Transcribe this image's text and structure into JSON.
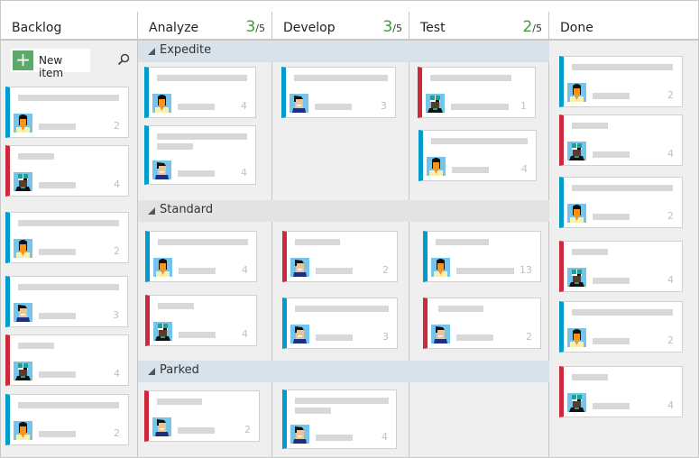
{
  "columns": [
    {
      "title": "Backlog"
    },
    {
      "title": "Analyze",
      "wip_current": "3",
      "wip_limit": "/5"
    },
    {
      "title": "Develop",
      "wip_current": "3",
      "wip_limit": "/5"
    },
    {
      "title": "Test",
      "wip_current": "2",
      "wip_limit": "/5"
    },
    {
      "title": "Done"
    }
  ],
  "backlog": {
    "new_item_label": "New item",
    "add_icon": "plus-icon",
    "search_icon": "search-icon"
  },
  "swimlanes": [
    {
      "label": "Expedite",
      "color": "#d7e2ea"
    },
    {
      "label": "Standard",
      "color": "#e3e3e3"
    },
    {
      "label": "Parked",
      "color": "#d7e2ea"
    }
  ],
  "colors": {
    "story": "#009ccc",
    "bug": "#cc293d",
    "wip_ok": "#3d9c3d",
    "new_item": "#5ea86b"
  },
  "cards": [
    {
      "col": 0,
      "type": "story",
      "avatar": "woman",
      "effort": "2"
    },
    {
      "col": 0,
      "type": "bug",
      "avatar": "cap",
      "effort": "4"
    },
    {
      "col": 0,
      "type": "story",
      "avatar": "woman",
      "effort": "2"
    },
    {
      "col": 0,
      "type": "story",
      "avatar": "man",
      "effort": "3"
    },
    {
      "col": 0,
      "type": "bug",
      "avatar": "cap",
      "effort": "4"
    },
    {
      "col": 0,
      "type": "story",
      "avatar": "woman",
      "effort": "2"
    },
    {
      "col": 1,
      "lane": "Expedite",
      "type": "story",
      "avatar": "woman",
      "effort": "4"
    },
    {
      "col": 1,
      "lane": "Expedite",
      "type": "story",
      "avatar": "man",
      "effort": "4"
    },
    {
      "col": 2,
      "lane": "Expedite",
      "type": "story",
      "avatar": "man",
      "effort": "3"
    },
    {
      "col": 3,
      "lane": "Expedite",
      "type": "bug",
      "avatar": "cap",
      "effort": "1"
    },
    {
      "col": 3,
      "lane": "Expedite",
      "type": "story",
      "avatar": "woman",
      "effort": "4"
    },
    {
      "col": 1,
      "lane": "Standard",
      "type": "story",
      "avatar": "woman",
      "effort": "4"
    },
    {
      "col": 1,
      "lane": "Standard",
      "type": "bug",
      "avatar": "cap",
      "effort": "4"
    },
    {
      "col": 2,
      "lane": "Standard",
      "type": "bug",
      "avatar": "man",
      "effort": "2"
    },
    {
      "col": 2,
      "lane": "Standard",
      "type": "story",
      "avatar": "man",
      "effort": "3"
    },
    {
      "col": 3,
      "lane": "Standard",
      "type": "story",
      "avatar": "woman",
      "effort": "13"
    },
    {
      "col": 3,
      "lane": "Standard",
      "type": "bug",
      "avatar": "man",
      "effort": "2"
    },
    {
      "col": 1,
      "lane": "Parked",
      "type": "bug",
      "avatar": "man",
      "effort": "2"
    },
    {
      "col": 2,
      "lane": "Parked",
      "type": "story",
      "avatar": "man",
      "effort": "4"
    },
    {
      "col": 4,
      "type": "story",
      "avatar": "woman",
      "effort": "2"
    },
    {
      "col": 4,
      "type": "bug",
      "avatar": "cap",
      "effort": "4"
    },
    {
      "col": 4,
      "type": "story",
      "avatar": "woman",
      "effort": "2"
    },
    {
      "col": 4,
      "type": "bug",
      "avatar": "cap",
      "effort": "4"
    },
    {
      "col": 4,
      "type": "story",
      "avatar": "woman",
      "effort": "2"
    },
    {
      "col": 4,
      "type": "bug",
      "avatar": "cap",
      "effort": "4"
    }
  ]
}
